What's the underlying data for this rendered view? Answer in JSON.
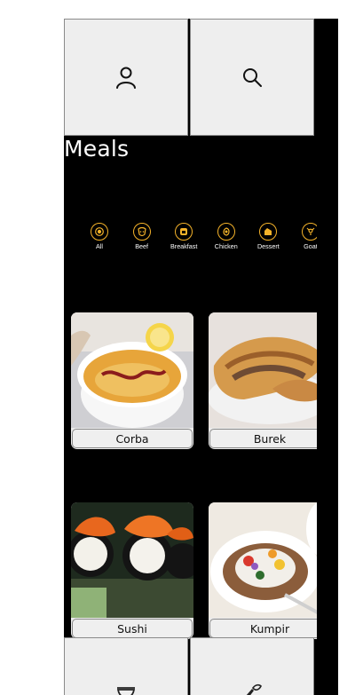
{
  "header": {
    "profile_icon": "user-icon",
    "search_icon": "search-icon"
  },
  "page": {
    "title": "Meals"
  },
  "categories": [
    {
      "label": "All",
      "icon": "plate-icon"
    },
    {
      "label": "Beef",
      "icon": "cow-icon"
    },
    {
      "label": "Breakfast",
      "icon": "toast-icon"
    },
    {
      "label": "Chicken",
      "icon": "chicken-icon"
    },
    {
      "label": "Dessert",
      "icon": "cake-icon"
    },
    {
      "label": "Goat",
      "icon": "goat-icon"
    }
  ],
  "meals": [
    {
      "name": "Corba"
    },
    {
      "name": "Burek"
    },
    {
      "name": "Sushi"
    },
    {
      "name": "Kumpir"
    }
  ],
  "footer": {
    "left_icon": "bowl-icon",
    "right_icon": "ingredients-icon"
  },
  "colors": {
    "accent": "#f5b32a",
    "background": "#000000",
    "panel": "#eeeeee"
  }
}
